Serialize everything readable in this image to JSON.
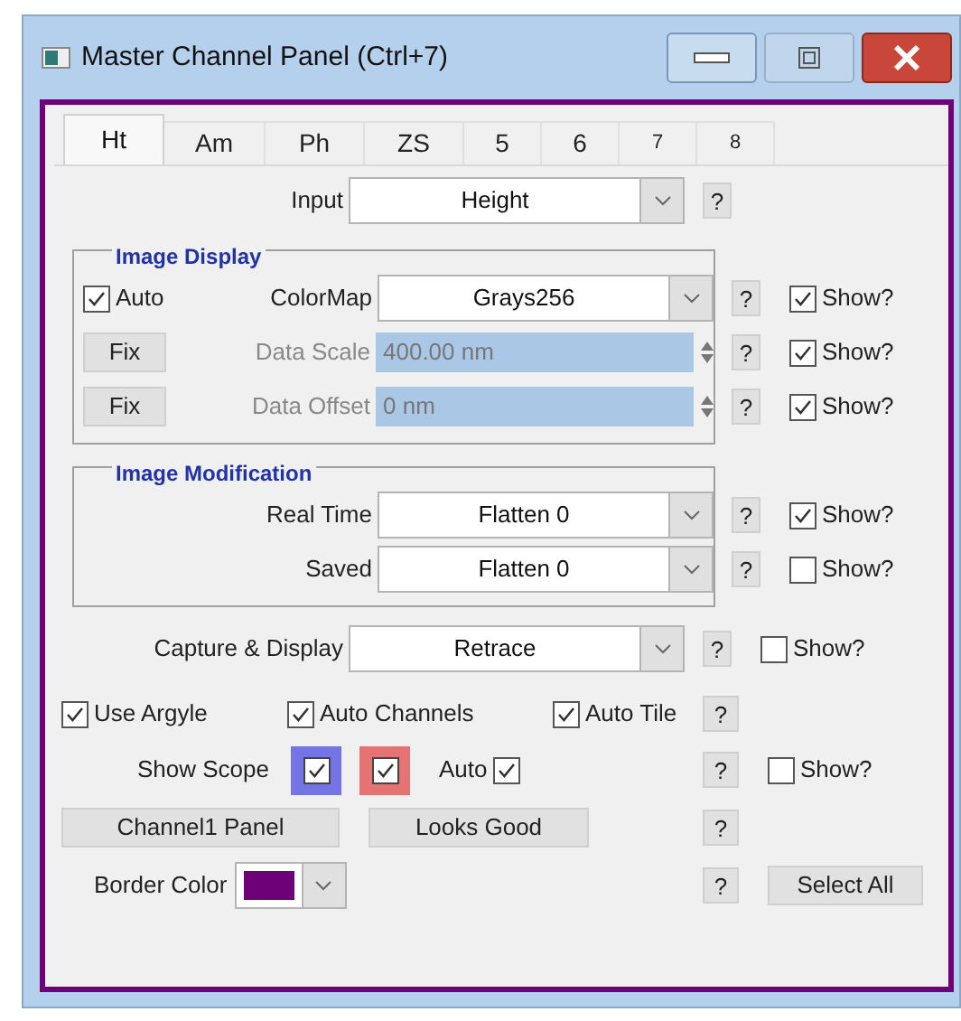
{
  "window": {
    "title": "Master Channel Panel (Ctrl+7)"
  },
  "tabs": [
    {
      "label": "Ht",
      "selected": true
    },
    {
      "label": "Am",
      "selected": false
    },
    {
      "label": "Ph",
      "selected": false
    },
    {
      "label": "ZS",
      "selected": false
    },
    {
      "label": "5",
      "selected": false
    },
    {
      "label": "6",
      "selected": false
    },
    {
      "label": "7",
      "selected": false,
      "small": true
    },
    {
      "label": "8",
      "selected": false,
      "small": true
    }
  ],
  "input": {
    "kind": "select",
    "label": "Input",
    "value": "Height",
    "help": "?"
  },
  "image_display": {
    "title": "Image Display",
    "rows": [
      {
        "kind": "select",
        "toggle": {
          "label": "Auto",
          "checked": true
        },
        "label": "ColorMap",
        "value": "Grays256",
        "help": "?",
        "show": {
          "label": "Show?",
          "checked": true
        }
      },
      {
        "kind": "spin",
        "button": "Fix",
        "label": "Data Scale",
        "value": "400.00 nm",
        "disabled": true,
        "help": "?",
        "show": {
          "label": "Show?",
          "checked": true
        }
      },
      {
        "kind": "spin",
        "button": "Fix",
        "label": "Data Offset",
        "value": "0 nm",
        "disabled": true,
        "help": "?",
        "show": {
          "label": "Show?",
          "checked": true
        }
      }
    ]
  },
  "image_modification": {
    "title": "Image Modification",
    "rows": [
      {
        "kind": "select",
        "label": "Real Time",
        "value": "Flatten 0",
        "help": "?",
        "show": {
          "label": "Show?",
          "checked": true
        }
      },
      {
        "kind": "select",
        "label": "Saved",
        "value": "Flatten 0",
        "help": "?",
        "show": {
          "label": "Show?",
          "checked": false
        }
      }
    ]
  },
  "capture": {
    "kind": "select",
    "label": "Capture & Display",
    "value": "Retrace",
    "help": "?",
    "show": {
      "label": "Show?",
      "checked": false
    }
  },
  "options": {
    "checkboxes": [
      {
        "label": "Use Argyle",
        "checked": true
      },
      {
        "label": "Auto Channels",
        "checked": true
      },
      {
        "label": "Auto Tile",
        "checked": true
      }
    ],
    "help": "?"
  },
  "scope": {
    "label": "Show Scope",
    "swatches": [
      {
        "color": "#7474e4",
        "checked": true
      },
      {
        "color": "#e47474",
        "checked": true
      }
    ],
    "auto": {
      "label": "Auto",
      "checked": true
    },
    "help": "?",
    "show": {
      "label": "Show?",
      "checked": false
    }
  },
  "actions": {
    "buttons": [
      "Channel1 Panel",
      "Looks Good"
    ],
    "help": "?"
  },
  "border": {
    "label": "Border Color",
    "color": "#6e0078",
    "help": "?",
    "select_all": "Select All"
  }
}
